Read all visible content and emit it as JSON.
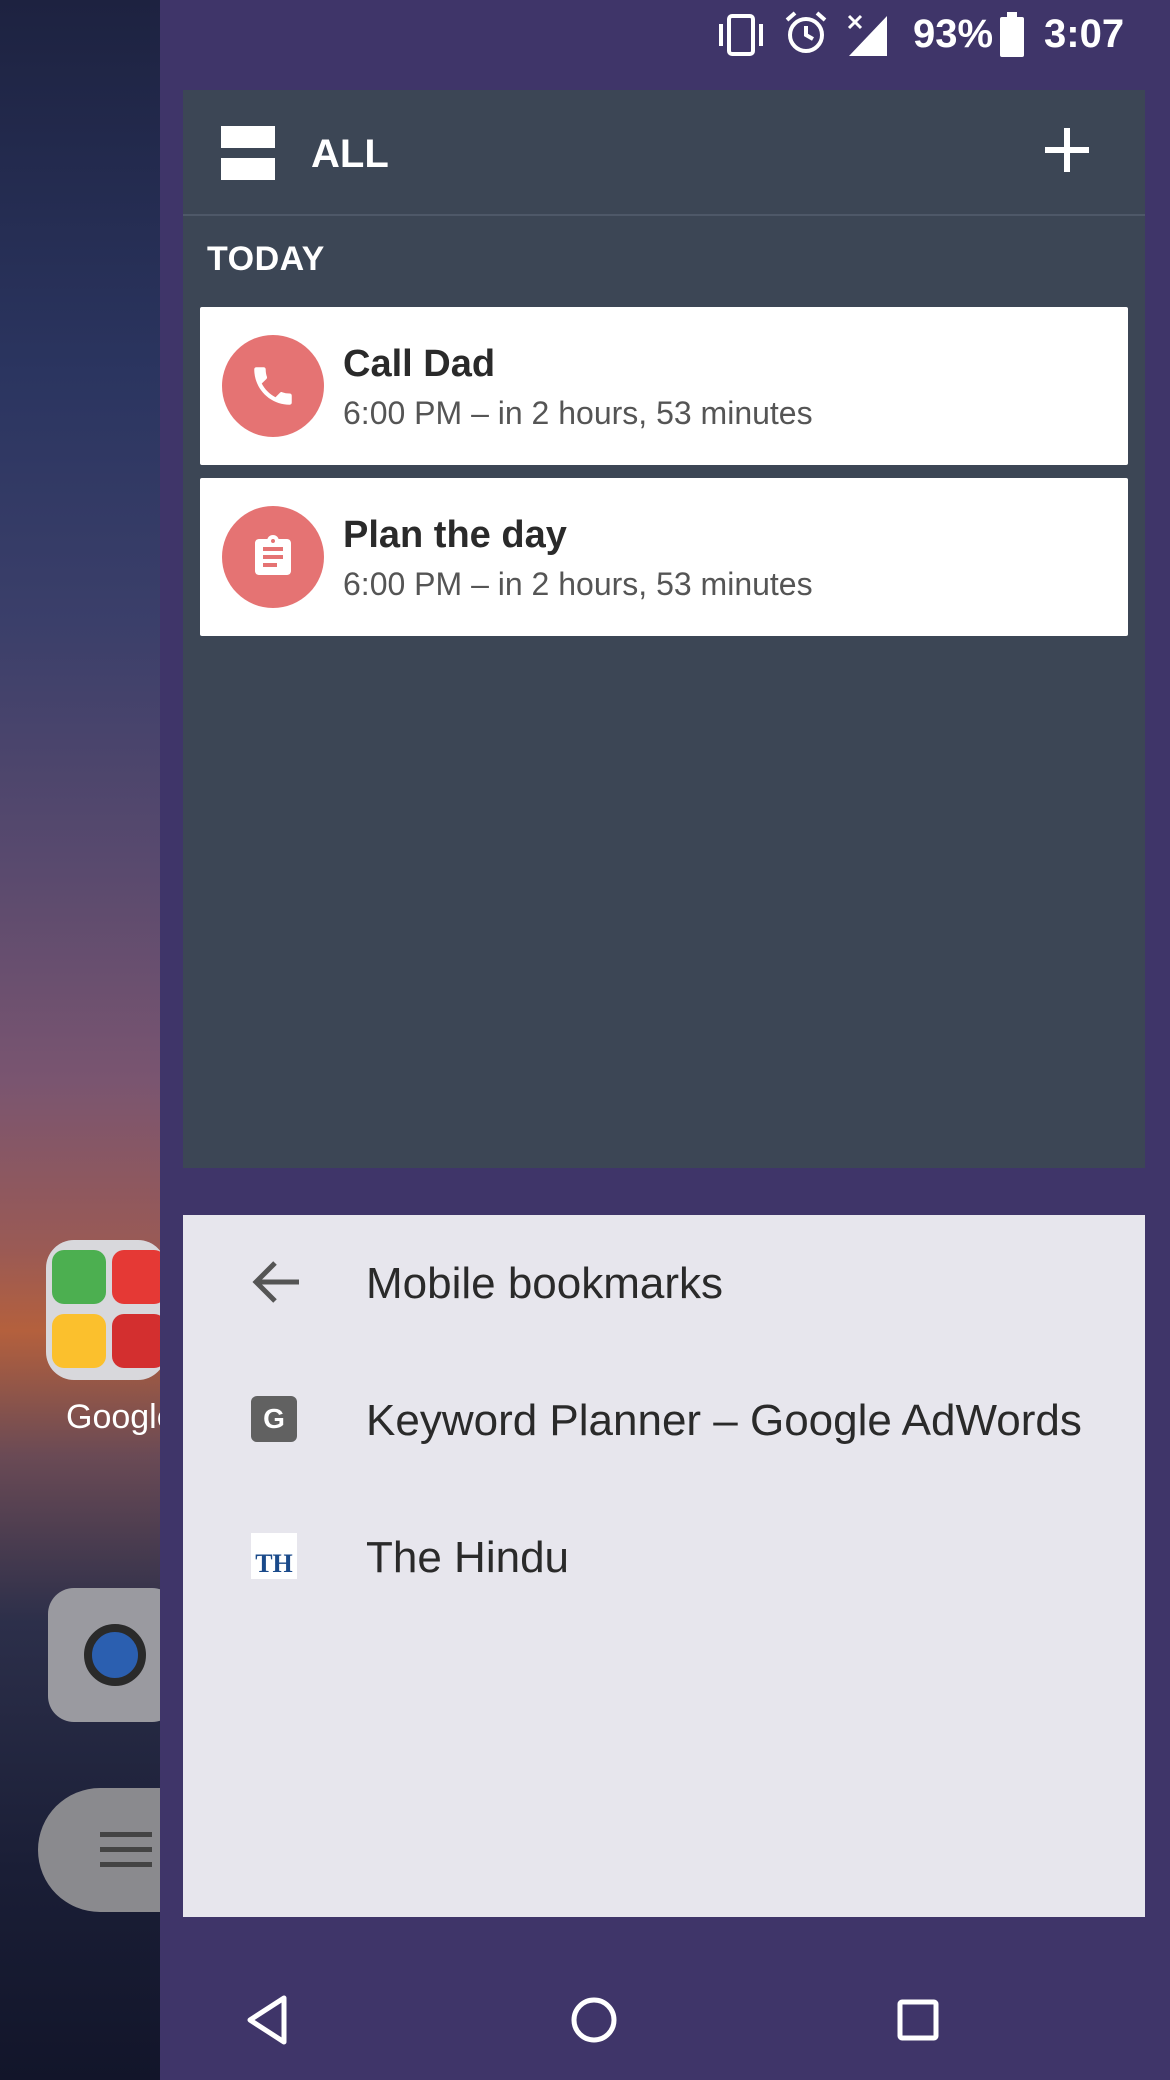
{
  "status_bar": {
    "battery_percent": "93%",
    "time": "3:07",
    "icons": [
      "vibrate-icon",
      "alarm-icon",
      "signal-icon",
      "battery-icon"
    ]
  },
  "home_screen": {
    "folder_label": "Google"
  },
  "widget": {
    "header_title": "ALL",
    "add_icon": "plus-icon",
    "section_label": "TODAY",
    "tasks": [
      {
        "title": "Call Dad",
        "subtitle": "6:00 PM – in 2 hours, 53 minutes",
        "icon": "phone-icon"
      },
      {
        "title": "Plan the day",
        "subtitle": "6:00 PM – in 2 hours, 53 minutes",
        "icon": "clipboard-icon"
      }
    ],
    "accent_color": "#e57373"
  },
  "bookmarks": {
    "back_label": "Mobile bookmarks",
    "items": [
      {
        "label": "Keyword Planner – Google AdWords",
        "favicon_text": "G"
      },
      {
        "label": "The Hindu",
        "favicon_text": "TH"
      }
    ]
  },
  "nav_bar": {
    "buttons": [
      "back-icon",
      "home-icon",
      "recents-icon"
    ]
  }
}
